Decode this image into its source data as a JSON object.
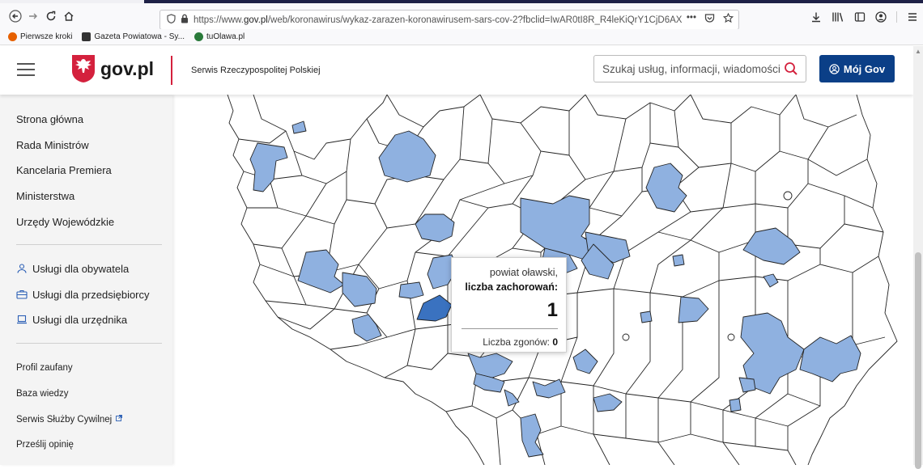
{
  "browser": {
    "url_prefix": "https://www.",
    "url_domain": "gov.pl",
    "url_rest": "/web/koronawirus/wykaz-zarazen-koronawirusem-sars-cov-2?fbclid=IwAR0tI8R_R4leKiQrY1CjD6AX",
    "more_label": "•••",
    "bookmarks": [
      {
        "label": "Pierwsze kroki",
        "color": "#e66000"
      },
      {
        "label": "Gazeta Powiatowa - Sy...",
        "color": "#333333"
      },
      {
        "label": "tuOlawa.pl",
        "color": "#2a7a3a"
      }
    ]
  },
  "header": {
    "logo_text": "gov.pl",
    "tagline": "Serwis Rzeczypospolitej Polskiej",
    "search_placeholder": "Szukaj usług, informacji, wiadomości",
    "account_button": "Mój Gov",
    "accent_color": "#0b3f87",
    "divider_color": "#d4213d"
  },
  "sidebar": {
    "main_items": [
      {
        "label": "Strona główna"
      },
      {
        "label": "Rada Ministrów"
      },
      {
        "label": "Kancelaria Premiera"
      },
      {
        "label": "Ministerstwa"
      },
      {
        "label": "Urzędy Wojewódzkie"
      }
    ],
    "service_items": [
      {
        "label": "Usługi dla obywatela",
        "icon": "person-icon"
      },
      {
        "label": "Usługi dla przedsiębiorcy",
        "icon": "briefcase-icon"
      },
      {
        "label": "Usługi dla urzędnika",
        "icon": "laptop-icon"
      }
    ],
    "footer_items": [
      {
        "label": "Profil zaufany"
      },
      {
        "label": "Baza wiedzy"
      },
      {
        "label": "Serwis Służby Cywilnej"
      },
      {
        "label": "Prześlij opinię"
      }
    ]
  },
  "map": {
    "fill_infected": "#8fb1e0",
    "fill_selected": "#3a72c0",
    "fill_none": "#ffffff",
    "stroke": "#222222"
  },
  "tooltip": {
    "region_name": "powiat oławski,",
    "cases_label": "liczba zachorowań:",
    "cases_value": "1",
    "deaths_label": "Liczba zgonów:",
    "deaths_value": "0"
  }
}
